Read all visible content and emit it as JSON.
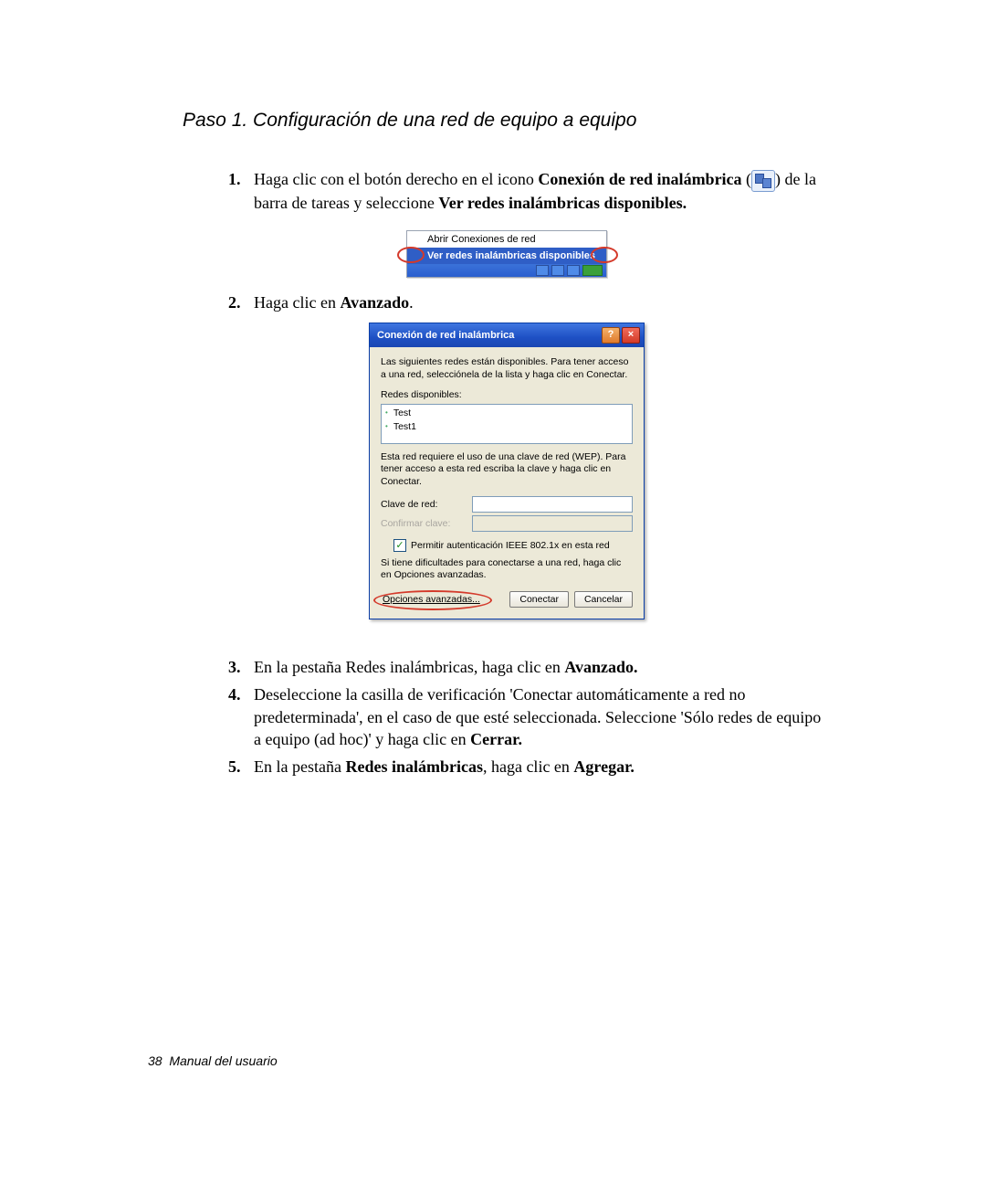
{
  "section_title": "Paso 1. Configuración de una red de equipo a equipo",
  "steps": {
    "s1a": "Haga clic con el botón derecho en el icono ",
    "s1_bold": "Conexión de red inalámbrica",
    "s1b": " (",
    "s1c": ") de la barra de tareas y seleccione ",
    "s1_bold2": "Ver redes inalámbricas disponibles.",
    "s2a": "Haga clic en ",
    "s2_bold": "Avanzado",
    "s2b": ".",
    "s3a": "En la pestaña Redes inalámbricas, haga clic en ",
    "s3_bold": "Avanzado.",
    "s4a": "Deseleccione la casilla de verificación 'Conectar automáticamente a red no predeterminada', en el caso de que esté seleccionada. Seleccione 'Sólo redes de equipo a equipo (ad hoc)' y haga clic en ",
    "s4_bold": "Cerrar.",
    "s5a": "En la pestaña ",
    "s5_bold1": "Redes inalámbricas",
    "s5b": ", haga clic en ",
    "s5_bold2": "Agregar."
  },
  "ctxmenu": {
    "item1": "Abrir Conexiones de red",
    "item2": "Ver redes inalámbricas disponibles"
  },
  "dialog": {
    "title": "Conexión de red inalámbrica",
    "desc": "Las siguientes redes están disponibles. Para tener acceso a una red, selecciónela de la lista y haga clic en Conectar.",
    "list_label": "Redes disponibles:",
    "items": [
      "Test",
      "Test1"
    ],
    "wep_note": "Esta red requiere el uso de una clave de red (WEP). Para tener acceso a esta red escriba la clave y haga clic en Conectar.",
    "key_label": "Clave de red:",
    "confirm_label": "Confirmar clave:",
    "ieee_label": "Permitir autenticación IEEE 802.1x en esta red",
    "trouble": "Si tiene dificultades para conectarse a una red, haga clic en Opciones avanzadas.",
    "adv_btn": "Opciones avanzadas...",
    "connect_btn": "Conectar",
    "cancel_btn": "Cancelar"
  },
  "footer": {
    "page": "38",
    "label": "Manual del usuario"
  }
}
